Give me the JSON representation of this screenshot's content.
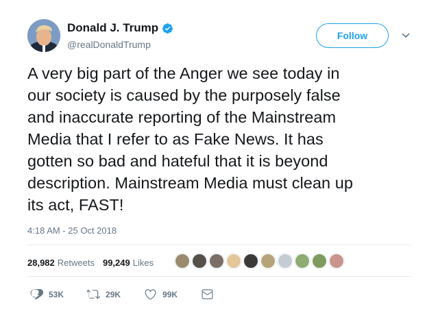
{
  "author": {
    "display_name": "Donald J. Trump",
    "handle": "@realDonaldTrump",
    "verified": true
  },
  "follow_label": "Follow",
  "tweet": {
    "text": "A very big part of the Anger we see today in\nour society is caused by the purposely false\nand inaccurate reporting of the Mainstream\nMedia that I refer to as Fake News. It has\ngotten so bad and hateful that it is beyond\ndescription. Mainstream Media must clean up\nits act, FAST!",
    "timestamp": "4:18 AM - 25 Oct 2018"
  },
  "stats": {
    "retweets_count": "28,982",
    "retweets_label": "Retweets",
    "likes_count": "99,249",
    "likes_label": "Likes"
  },
  "likers": [
    {
      "color": "#9a8a6e"
    },
    {
      "color": "#55504a"
    },
    {
      "color": "#7a6f65"
    },
    {
      "color": "#e2c79a"
    },
    {
      "color": "#3b3a38"
    },
    {
      "color": "#b7a37a"
    },
    {
      "color": "#c4cbd2"
    },
    {
      "color": "#8eab72"
    },
    {
      "color": "#7f9a5f"
    },
    {
      "color": "#c9948c"
    }
  ],
  "actions": {
    "reply_count": "53K",
    "retweet_count": "29K",
    "like_count": "99K"
  },
  "icons": {
    "avatar": "profile-photo",
    "verified": "verified-badge-icon",
    "caret": "chevron-down-icon",
    "reply": "reply-icon",
    "retweet": "retweet-icon",
    "like": "heart-icon",
    "message": "envelope-icon"
  },
  "colors": {
    "accent": "#1da1f2",
    "text": "#14171a",
    "muted": "#657786"
  }
}
